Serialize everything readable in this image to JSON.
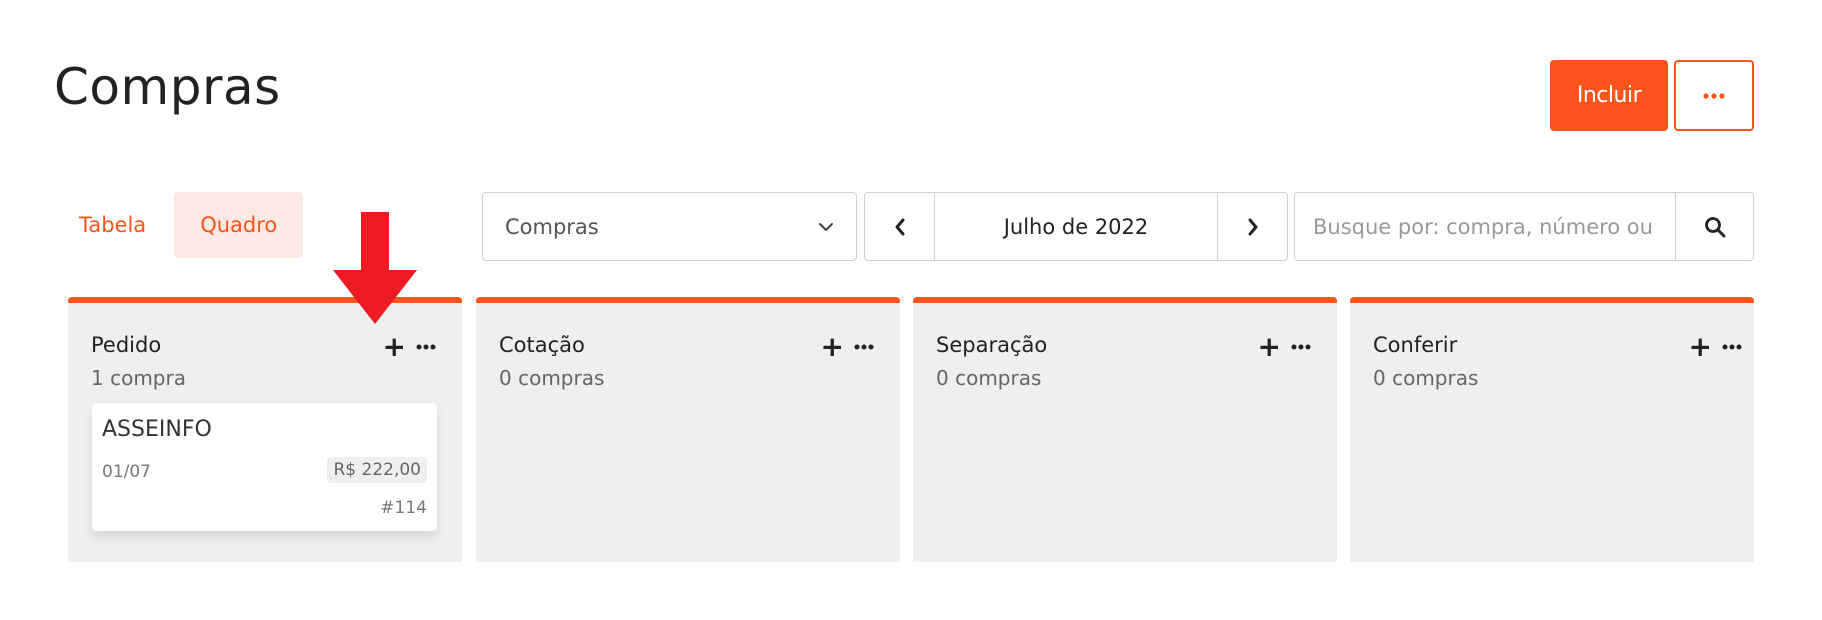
{
  "page": {
    "title": "Compras"
  },
  "header": {
    "primary_button": "Incluir",
    "more_button_icon": "more-horizontal-icon"
  },
  "view_tabs": [
    {
      "label": "Tabela",
      "active": false
    },
    {
      "label": "Quadro",
      "active": true
    }
  ],
  "filter": {
    "selected": "Compras"
  },
  "date_nav": {
    "label": "Julho de 2022"
  },
  "search": {
    "placeholder": "Busque por: compra, número ou fornecedor"
  },
  "columns": [
    {
      "title": "Pedido",
      "count": "1 compra",
      "cards": [
        {
          "title": "ASSEINFO",
          "date": "01/07",
          "value": "R$ 222,00",
          "number": "#114"
        }
      ]
    },
    {
      "title": "Cotação",
      "count": "0 compras",
      "cards": []
    },
    {
      "title": "Separação",
      "count": "0 compras",
      "cards": []
    },
    {
      "title": "Conferir",
      "count": "0 compras",
      "cards": []
    }
  ],
  "colors": {
    "accent": "#fa541c",
    "accent_light": "#fde9e3",
    "column_bg": "#efefef",
    "annotation_arrow": "#ed1c24"
  }
}
